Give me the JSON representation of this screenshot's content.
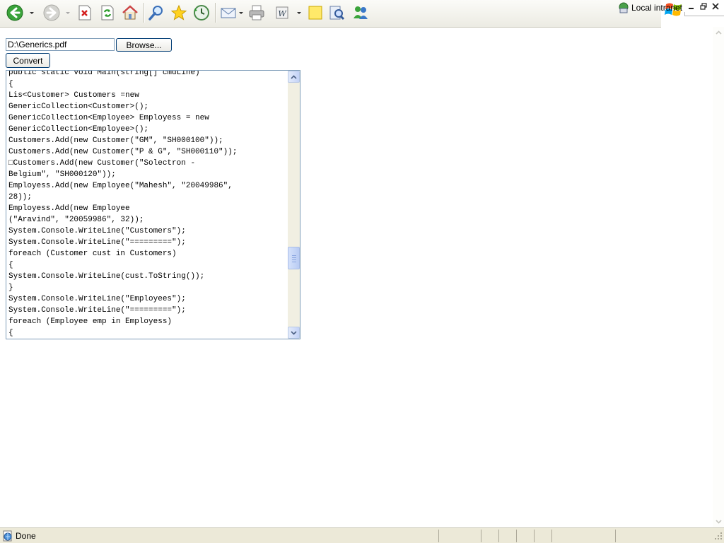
{
  "form": {
    "file_value": "D:\\Generics.pdf",
    "browse_label": "Browse...",
    "convert_label": "Convert"
  },
  "code_lines": [
    "public static void Main(string[] cmdLine)",
    "{",
    "Lis<Customer> Customers =new",
    "GenericCollection<Customer>();",
    "GenericCollection<Employee> Employess = new",
    "GenericCollection<Employee>();",
    "Customers.Add(new Customer(\"GM\", \"SH000100\"));",
    "Customers.Add(new Customer(\"P & G\", \"SH000110\"));",
    "□Customers.Add(new Customer(\"Solectron -",
    "Belgium\", \"SH000120\"));",
    "Employess.Add(new Employee(\"Mahesh\", \"20049986\",",
    "28));",
    "Employess.Add(new Employee",
    "(\"Aravind\", \"20059986\", 32));",
    "System.Console.WriteLine(\"Customers\");",
    "System.Console.WriteLine(\"=========\");",
    "foreach (Customer cust in Customers)",
    "{",
    "System.Console.WriteLine(cust.ToString());",
    "}",
    "System.Console.WriteLine(\"Employees\");",
    "System.Console.WriteLine(\"=========\");",
    "foreach (Employee emp in Employess)",
    "{"
  ],
  "code_scroll": {
    "thumb_position_fraction": 0.7
  },
  "status": {
    "text": "Done",
    "zone": "Local intranet"
  },
  "toolbar_icons": [
    "back-icon",
    "forward-icon",
    "stop-icon",
    "refresh-icon",
    "home-icon",
    "search-icon",
    "favorites-icon",
    "history-icon",
    "mail-icon",
    "print-icon",
    "edit-word-icon",
    "discuss-icon",
    "research-icon",
    "messenger-icon"
  ],
  "colors": {
    "toolbar_bg": "#ecebe3",
    "button_border": "#003c74",
    "input_border": "#7f9db9",
    "status_bg": "#ece9d8",
    "scroll_thumb": "#c4d3f7"
  }
}
